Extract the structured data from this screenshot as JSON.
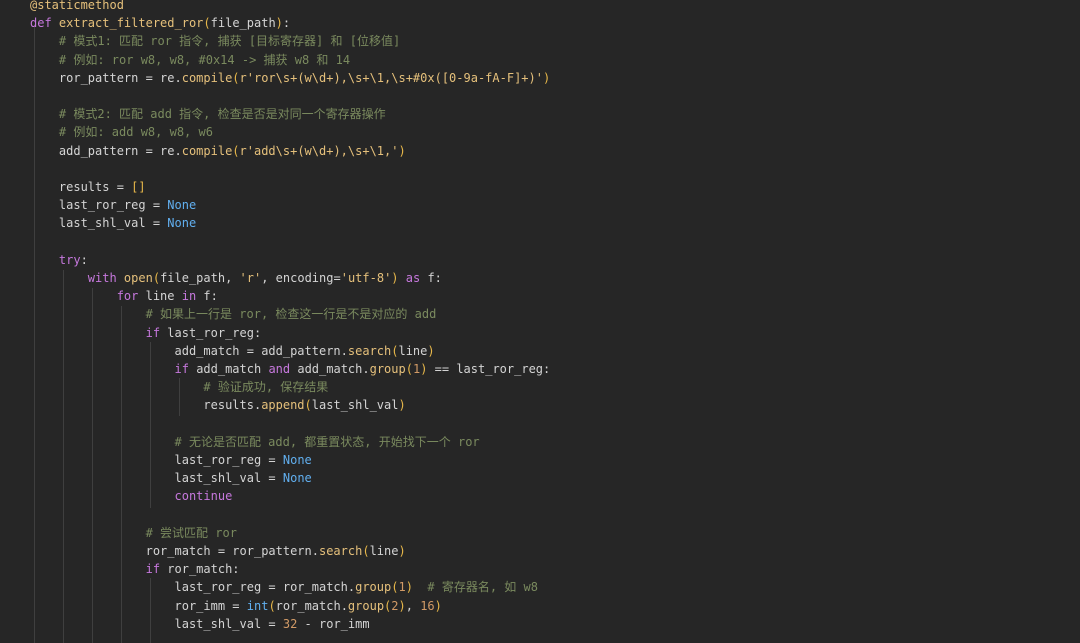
{
  "editor": {
    "language": "python",
    "theme": {
      "background": "#262626",
      "keyword": "#c678dd",
      "function": "#e5c07b",
      "comment": "#7a8a5e",
      "string": "#e5c07b",
      "number": "#d19a66",
      "constant": "#61afef",
      "text": "#d4d4d4"
    },
    "lines": [
      [
        {
          "t": "deco",
          "v": "@staticmethod"
        }
      ],
      [
        {
          "t": "kw",
          "v": "def "
        },
        {
          "t": "fn",
          "v": "extract_filtered_ror"
        },
        {
          "t": "paren",
          "v": "("
        },
        {
          "t": "plain",
          "v": "file_path"
        },
        {
          "t": "paren",
          "v": ")"
        },
        {
          "t": "plain",
          "v": ":"
        }
      ],
      [
        {
          "t": "plain",
          "v": "    "
        },
        {
          "t": "cm",
          "v": "# 模式1: 匹配 ror 指令, 捕获 [目标寄存器] 和 [位移值]"
        }
      ],
      [
        {
          "t": "plain",
          "v": "    "
        },
        {
          "t": "cm",
          "v": "# 例如: ror w8, w8, #0x14 -> 捕获 w8 和 14"
        }
      ],
      [
        {
          "t": "plain",
          "v": "    ror_pattern = re."
        },
        {
          "t": "fn",
          "v": "compile"
        },
        {
          "t": "paren",
          "v": "("
        },
        {
          "t": "str",
          "v": "r'ror\\s+(w\\d+),\\s+\\1,\\s+#0x([0-9a-fA-F]+)'"
        },
        {
          "t": "paren",
          "v": ")"
        }
      ],
      [],
      [
        {
          "t": "plain",
          "v": "    "
        },
        {
          "t": "cm",
          "v": "# 模式2: 匹配 add 指令, 检查是否是对同一个寄存器操作"
        }
      ],
      [
        {
          "t": "plain",
          "v": "    "
        },
        {
          "t": "cm",
          "v": "# 例如: add w8, w8, w6"
        }
      ],
      [
        {
          "t": "plain",
          "v": "    add_pattern = re."
        },
        {
          "t": "fn",
          "v": "compile"
        },
        {
          "t": "paren",
          "v": "("
        },
        {
          "t": "str",
          "v": "r'add\\s+(w\\d+),\\s+\\1,'"
        },
        {
          "t": "paren",
          "v": ")"
        }
      ],
      [],
      [
        {
          "t": "plain",
          "v": "    results = "
        },
        {
          "t": "paren",
          "v": "[]"
        }
      ],
      [
        {
          "t": "plain",
          "v": "    last_ror_reg = "
        },
        {
          "t": "const",
          "v": "None"
        }
      ],
      [
        {
          "t": "plain",
          "v": "    last_shl_val = "
        },
        {
          "t": "const",
          "v": "None"
        }
      ],
      [],
      [
        {
          "t": "plain",
          "v": "    "
        },
        {
          "t": "kw",
          "v": "try"
        },
        {
          "t": "plain",
          "v": ":"
        }
      ],
      [
        {
          "t": "plain",
          "v": "        "
        },
        {
          "t": "kw",
          "v": "with "
        },
        {
          "t": "fn",
          "v": "open"
        },
        {
          "t": "paren",
          "v": "("
        },
        {
          "t": "plain",
          "v": "file_path, "
        },
        {
          "t": "str",
          "v": "'r'"
        },
        {
          "t": "plain",
          "v": ", encoding="
        },
        {
          "t": "str",
          "v": "'utf-8'"
        },
        {
          "t": "paren",
          "v": ")"
        },
        {
          "t": "kw",
          "v": " as "
        },
        {
          "t": "plain",
          "v": "f:"
        }
      ],
      [
        {
          "t": "plain",
          "v": "            "
        },
        {
          "t": "kw",
          "v": "for "
        },
        {
          "t": "plain",
          "v": "line "
        },
        {
          "t": "kw",
          "v": "in "
        },
        {
          "t": "plain",
          "v": "f:"
        }
      ],
      [
        {
          "t": "plain",
          "v": "                "
        },
        {
          "t": "cm",
          "v": "# 如果上一行是 ror, 检查这一行是不是对应的 add"
        }
      ],
      [
        {
          "t": "plain",
          "v": "                "
        },
        {
          "t": "kw",
          "v": "if "
        },
        {
          "t": "plain",
          "v": "last_ror_reg:"
        }
      ],
      [
        {
          "t": "plain",
          "v": "                    add_match = add_pattern."
        },
        {
          "t": "fn",
          "v": "search"
        },
        {
          "t": "paren",
          "v": "("
        },
        {
          "t": "plain",
          "v": "line"
        },
        {
          "t": "paren",
          "v": ")"
        }
      ],
      [
        {
          "t": "plain",
          "v": "                    "
        },
        {
          "t": "kw",
          "v": "if "
        },
        {
          "t": "plain",
          "v": "add_match "
        },
        {
          "t": "kw",
          "v": "and "
        },
        {
          "t": "plain",
          "v": "add_match."
        },
        {
          "t": "fn",
          "v": "group"
        },
        {
          "t": "paren",
          "v": "("
        },
        {
          "t": "num",
          "v": "1"
        },
        {
          "t": "paren",
          "v": ")"
        },
        {
          "t": "plain",
          "v": " == last_ror_reg:"
        }
      ],
      [
        {
          "t": "plain",
          "v": "                        "
        },
        {
          "t": "cm",
          "v": "# 验证成功, 保存结果"
        }
      ],
      [
        {
          "t": "plain",
          "v": "                        results."
        },
        {
          "t": "fn",
          "v": "append"
        },
        {
          "t": "paren",
          "v": "("
        },
        {
          "t": "plain",
          "v": "last_shl_val"
        },
        {
          "t": "paren",
          "v": ")"
        }
      ],
      [],
      [
        {
          "t": "plain",
          "v": "                    "
        },
        {
          "t": "cm",
          "v": "# 无论是否匹配 add, 都重置状态, 开始找下一个 ror"
        }
      ],
      [
        {
          "t": "plain",
          "v": "                    last_ror_reg = "
        },
        {
          "t": "const",
          "v": "None"
        }
      ],
      [
        {
          "t": "plain",
          "v": "                    last_shl_val = "
        },
        {
          "t": "const",
          "v": "None"
        }
      ],
      [
        {
          "t": "plain",
          "v": "                    "
        },
        {
          "t": "kw",
          "v": "continue"
        }
      ],
      [],
      [
        {
          "t": "plain",
          "v": "                "
        },
        {
          "t": "cm",
          "v": "# 尝试匹配 ror"
        }
      ],
      [
        {
          "t": "plain",
          "v": "                ror_match = ror_pattern."
        },
        {
          "t": "fn",
          "v": "search"
        },
        {
          "t": "paren",
          "v": "("
        },
        {
          "t": "plain",
          "v": "line"
        },
        {
          "t": "paren",
          "v": ")"
        }
      ],
      [
        {
          "t": "plain",
          "v": "                "
        },
        {
          "t": "kw",
          "v": "if "
        },
        {
          "t": "plain",
          "v": "ror_match:"
        }
      ],
      [
        {
          "t": "plain",
          "v": "                    last_ror_reg = ror_match."
        },
        {
          "t": "fn",
          "v": "group"
        },
        {
          "t": "paren",
          "v": "("
        },
        {
          "t": "num",
          "v": "1"
        },
        {
          "t": "paren",
          "v": ")"
        },
        {
          "t": "plain",
          "v": "  "
        },
        {
          "t": "cm",
          "v": "# 寄存器名, 如 w8"
        }
      ],
      [
        {
          "t": "plain",
          "v": "                    ror_imm = "
        },
        {
          "t": "builtin",
          "v": "int"
        },
        {
          "t": "paren",
          "v": "("
        },
        {
          "t": "plain",
          "v": "ror_match."
        },
        {
          "t": "fn",
          "v": "group"
        },
        {
          "t": "paren",
          "v": "("
        },
        {
          "t": "num",
          "v": "2"
        },
        {
          "t": "paren",
          "v": ")"
        },
        {
          "t": "plain",
          "v": ", "
        },
        {
          "t": "num",
          "v": "16"
        },
        {
          "t": "paren",
          "v": ")"
        }
      ],
      [
        {
          "t": "plain",
          "v": "                    last_shl_val = "
        },
        {
          "t": "num",
          "v": "32"
        },
        {
          "t": "plain",
          "v": " - ror_imm"
        }
      ]
    ]
  }
}
